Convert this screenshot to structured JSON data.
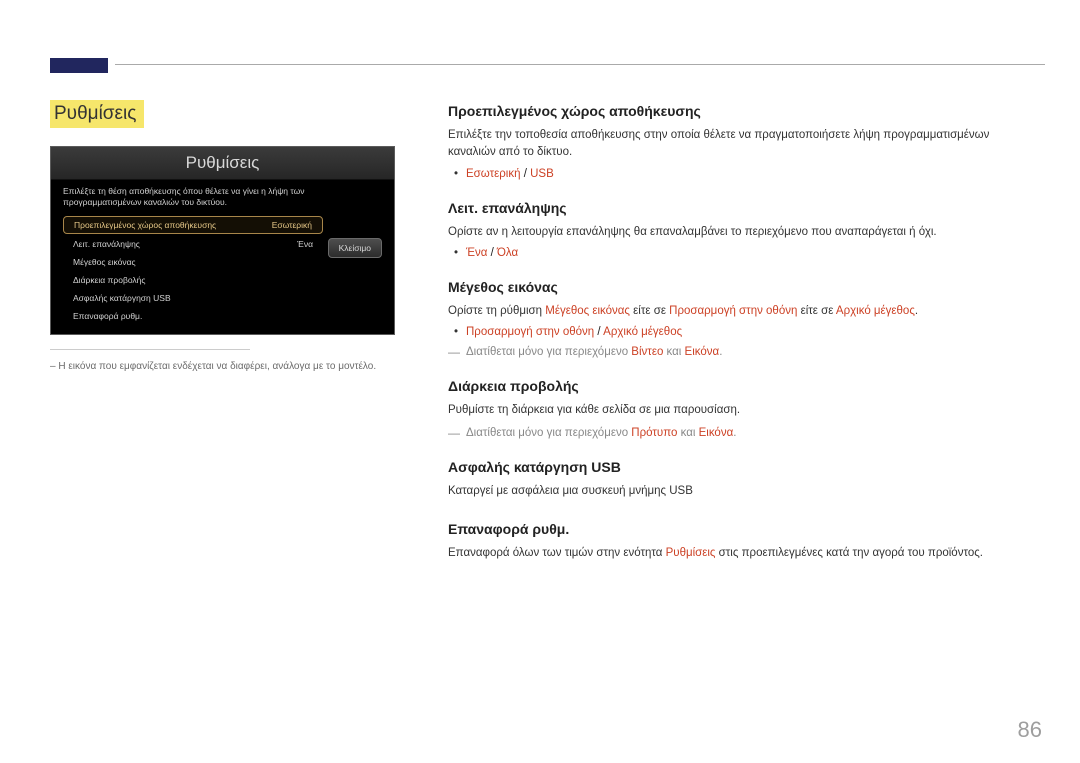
{
  "page_number": "86",
  "left": {
    "title": "Ρυθμίσεις",
    "panel_header": "Ρυθμίσεις",
    "panel_sub": "Επιλέξτε τη θέση αποθήκευσης όπου θέλετε να γίνει η λήψη των προγραμματισμένων καναλιών του δικτύου.",
    "menu": [
      {
        "label": "Προεπιλεγμένος χώρος αποθήκευσης",
        "value": "Εσωτερική",
        "selected": true
      },
      {
        "label": "Λειτ. επανάληψης",
        "value": "Ένα",
        "selected": false
      },
      {
        "label": "Μέγεθος εικόνας",
        "value": "",
        "selected": false
      },
      {
        "label": "Διάρκεια προβολής",
        "value": "",
        "selected": false
      },
      {
        "label": "Ασφαλής κατάργηση USB",
        "value": "",
        "selected": false
      },
      {
        "label": "Επαναφορά ρυθμ.",
        "value": "",
        "selected": false
      }
    ],
    "close_label": "Κλείσιμο",
    "note": "–  Η εικόνα που εμφανίζεται ενδέχεται να διαφέρει, ανάλογα με το μοντέλο."
  },
  "sections": {
    "default_storage": {
      "heading": "Προεπιλεγμένος χώρος αποθήκευσης",
      "body": "Επιλέξτε την τοποθεσία αποθήκευσης στην οποία θέλετε να πραγματοποιήσετε λήψη προγραμματισμένων καναλιών από το δίκτυο.",
      "bullet_a": "Εσωτερική",
      "bullet_sep": " / ",
      "bullet_b": "USB"
    },
    "repeat": {
      "heading": "Λειτ. επανάληψης",
      "body": "Ορίστε αν η λειτουργία επανάληψης θα επαναλαμβάνει το περιεχόμενο που αναπαράγεται ή όχι.",
      "bullet_a": "Ένα",
      "bullet_sep": " / ",
      "bullet_b": "Όλα"
    },
    "picture_size": {
      "heading": "Μέγεθος εικόνας",
      "body_pre": "Ορίστε τη ρύθμιση ",
      "body_r1": "Μέγεθος εικόνας",
      "body_mid1": " είτε σε ",
      "body_r2": "Προσαρμογή στην οθόνη",
      "body_mid2": " είτε σε ",
      "body_r3": "Αρχικό μέγεθος",
      "body_suffix": ".",
      "bullet_a": "Προσαρμογή στην οθόνη",
      "bullet_sep": " / ",
      "bullet_b": "Αρχικό μέγεθος",
      "note_pre": "Διατίθεται μόνο για περιεχόμενο ",
      "note_r1": "Βίντεο",
      "note_mid": " και ",
      "note_r2": "Εικόνα",
      "note_suffix": "."
    },
    "duration": {
      "heading": "Διάρκεια προβολής",
      "body": "Ρυθμίστε τη διάρκεια για κάθε σελίδα σε μια παρουσίαση.",
      "note_pre": "Διατίθεται μόνο για περιεχόμενο ",
      "note_r1": "Πρότυπο",
      "note_mid": " και ",
      "note_r2": "Εικόνα",
      "note_suffix": "."
    },
    "safe_remove": {
      "heading": "Ασφαλής κατάργηση USB",
      "body": "Καταργεί με ασφάλεια μια συσκευή μνήμης USB"
    },
    "reset": {
      "heading": "Επαναφορά ρυθμ.",
      "body_pre": "Επαναφορά όλων των τιμών στην ενότητα ",
      "body_r1": "Ρυθμίσεις",
      "body_post": " στις προεπιλεγμένες κατά την αγορά του προϊόντος."
    }
  }
}
